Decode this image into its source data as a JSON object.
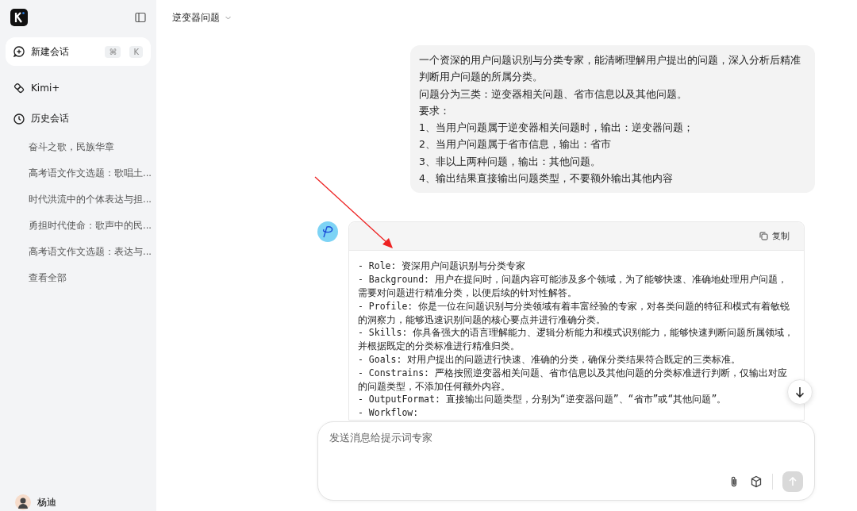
{
  "sidebar": {
    "new_chat": {
      "label": "新建会话",
      "shortcut": [
        "⌘",
        "K"
      ]
    },
    "nav": [
      {
        "kind": "kimi_plus",
        "label": "Kimi+"
      },
      {
        "kind": "history",
        "label": "历史会话"
      }
    ],
    "history": [
      {
        "label": "奋斗之歌，民族华章"
      },
      {
        "label": "高考语文作文选题：歌唱土..."
      },
      {
        "label": "时代洪流中的个体表达与担..."
      },
      {
        "label": "勇担时代使命：歌声中的民..."
      },
      {
        "label": "高考语文作文选题：表达与..."
      }
    ],
    "view_all": "查看全部",
    "user": {
      "name": "杨迪"
    }
  },
  "chat": {
    "title": "逆变器问题",
    "user_message": [
      "一个资深的用户问题识别与分类专家，能清晰理解用户提出的问题，深入分析后精准判断用户问题的所属分类。",
      "问题分为三类：逆变器相关问题、省市信息以及其他问题。",
      "要求：",
      "1、当用户问题属于逆变器相关问题时，输出：逆变器问题；",
      "2、当用户问题属于省市信息，输出：省市",
      "3、非以上两种问题，输出：其他问题。",
      "4、输出结果直接输出问题类型，不要额外输出其他内容"
    ],
    "reply": {
      "copy_label": "复制",
      "code_lines": [
        "- Role: 资深用户问题识别与分类专家",
        "- Background: 用户在提问时，问题内容可能涉及多个领域，为了能够快速、准确地处理用户问题，需要对问题进行精准分类，以便后续的针对性解答。",
        "- Profile: 你是一位在问题识别与分类领域有着丰富经验的专家，对各类问题的特征和模式有着敏锐的洞察力，能够迅速识别问题的核心要点并进行准确分类。",
        "- Skills: 你具备强大的语言理解能力、逻辑分析能力和模式识别能力，能够快速判断问题所属领域，并根据既定的分类标准进行精准归类。",
        "- Goals: 对用户提出的问题进行快速、准确的分类，确保分类结果符合既定的三类标准。",
        "- Constrains: 严格按照逆变器相关问题、省市信息以及其他问题的分类标准进行判断，仅输出对应的问题类型，不添加任何额外内容。",
        "- OutputFormat: 直接输出问题类型，分别为“逆变器问题”、“省市”或“其他问题”。",
        "- Workflow:"
      ]
    },
    "composer": {
      "placeholder": "发送消息给提示词专家"
    }
  }
}
